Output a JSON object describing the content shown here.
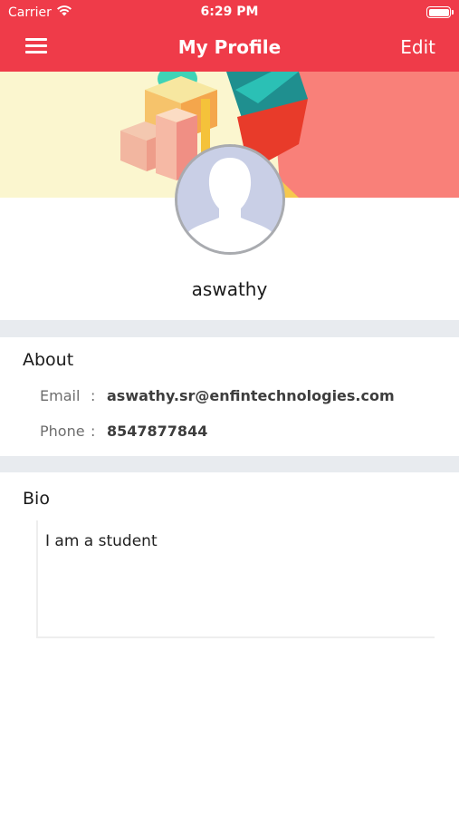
{
  "status_bar": {
    "carrier": "Carrier",
    "time": "6:29 PM",
    "wifi_icon": "wifi-icon",
    "battery_icon": "battery-icon"
  },
  "navbar": {
    "menu_icon": "hamburger-menu-icon",
    "title": "My Profile",
    "edit_label": "Edit",
    "color": "#ef3b49"
  },
  "profile": {
    "cover_image": "abstract-geometric-cover",
    "avatar_icon": "default-avatar-icon",
    "name": "aswathy"
  },
  "about": {
    "title": "About",
    "email_label": "Email",
    "email_value": "aswathy.sr@enfintechnologies.com",
    "phone_label": "Phone",
    "phone_value": "8547877844",
    "separator": ":"
  },
  "bio": {
    "title": "Bio",
    "text": "I am a student"
  }
}
